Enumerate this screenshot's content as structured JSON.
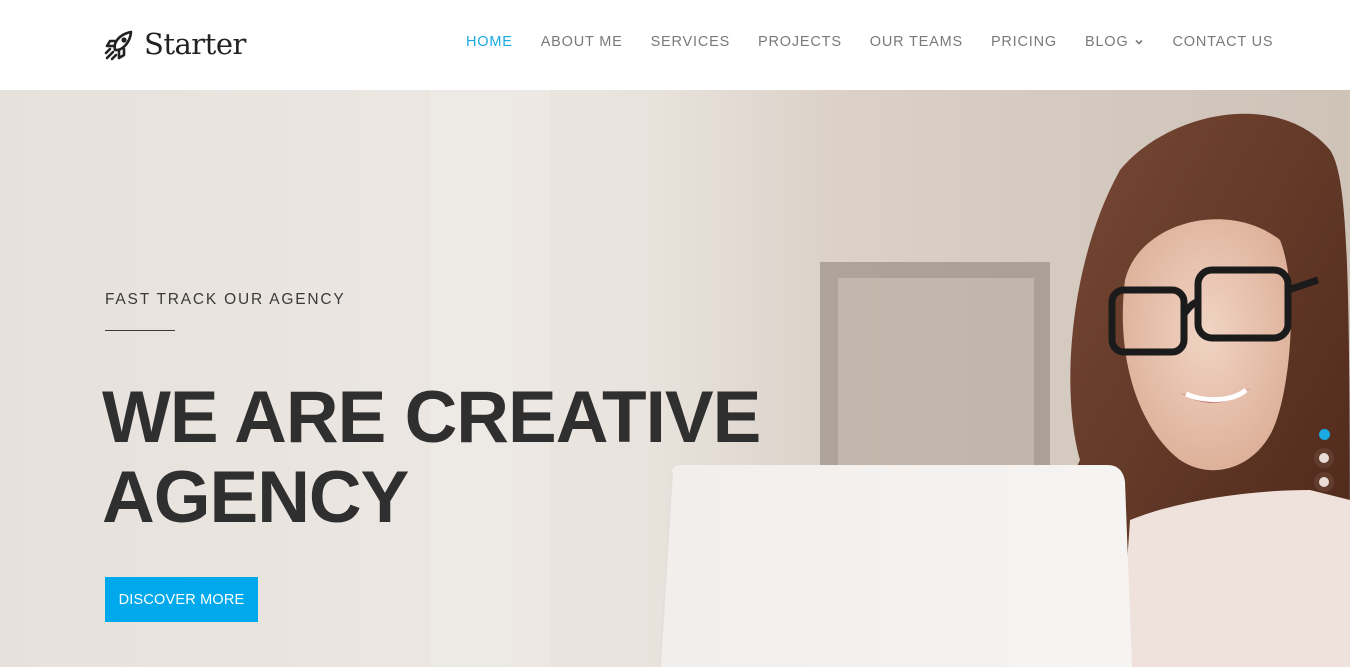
{
  "brand": {
    "name": "Starter",
    "logo_icon": "rocket-icon"
  },
  "nav": {
    "items": [
      {
        "label": "HOME",
        "active": true
      },
      {
        "label": "ABOUT ME",
        "active": false
      },
      {
        "label": "SERVICES",
        "active": false
      },
      {
        "label": "PROJECTS",
        "active": false
      },
      {
        "label": "OUR TEAMS",
        "active": false
      },
      {
        "label": "PRICING",
        "active": false
      },
      {
        "label": "BLOG",
        "active": false,
        "has_dropdown": true,
        "dropdown_icon": "chevron-down-icon"
      },
      {
        "label": "CONTACT US",
        "active": false
      }
    ]
  },
  "hero": {
    "kicker": "FAST TRACK OUR AGENCY",
    "headline_line1": "WE ARE CREATIVE",
    "headline_line2": "AGENCY",
    "cta_label": "DISCOVER MORE",
    "slider": {
      "total": 3,
      "active_index": 0
    },
    "image": "woman-with-glasses-using-laptop"
  },
  "colors": {
    "accent": "#1aa9e1",
    "cta_background": "#00a8ec",
    "headline": "#2f2f2f",
    "nav_text": "#7a7a7a"
  }
}
